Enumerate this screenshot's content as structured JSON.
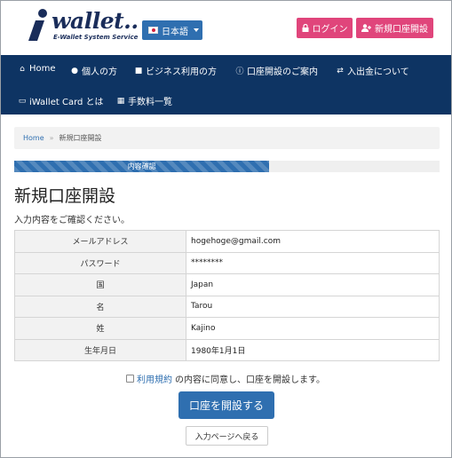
{
  "header": {
    "logo_word": "wallet..",
    "logo_tagline": "E-Wallet System Service",
    "language_button": "日本語",
    "login_button": "ログイン",
    "signup_button": "新規口座開設"
  },
  "nav": {
    "items": [
      {
        "label": "Home",
        "icon": "home-icon"
      },
      {
        "label": "個人の方",
        "icon": "person-icon"
      },
      {
        "label": "ビジネス利用の方",
        "icon": "briefcase-icon"
      },
      {
        "label": "口座開設のご案内",
        "icon": "info-icon"
      },
      {
        "label": "入出金について",
        "icon": "exchange-icon"
      },
      {
        "label": "iWallet Card とは",
        "icon": "credit-card-icon"
      },
      {
        "label": "手数料一覧",
        "icon": "calculator-icon"
      }
    ]
  },
  "breadcrumb": {
    "home": "Home",
    "separator": "»",
    "current": "新規口座開設"
  },
  "progress": {
    "label": "内容確認",
    "value": 0.6
  },
  "page": {
    "title": "新規口座開設",
    "subtitle": "入力内容をご確認ください。"
  },
  "confirm_table": {
    "rows": [
      {
        "label": "メールアドレス",
        "value": "hogehoge@gmail.com"
      },
      {
        "label": "パスワード",
        "value": "********"
      },
      {
        "label": "国",
        "value": "Japan"
      },
      {
        "label": "名",
        "value": "Tarou"
      },
      {
        "label": "姓",
        "value": "Kajino"
      },
      {
        "label": "生年月日",
        "value": "1980年1月1日"
      }
    ]
  },
  "agreement": {
    "terms_link": "利用規約",
    "text": "の内容に同意し、口座を開設します。"
  },
  "actions": {
    "open_account": "口座を開設する",
    "back": "入力ページへ戻る"
  },
  "colors": {
    "brand_navy": "#0e3463",
    "accent_blue": "#2f6fb0",
    "accent_pink": "#e0457b"
  }
}
